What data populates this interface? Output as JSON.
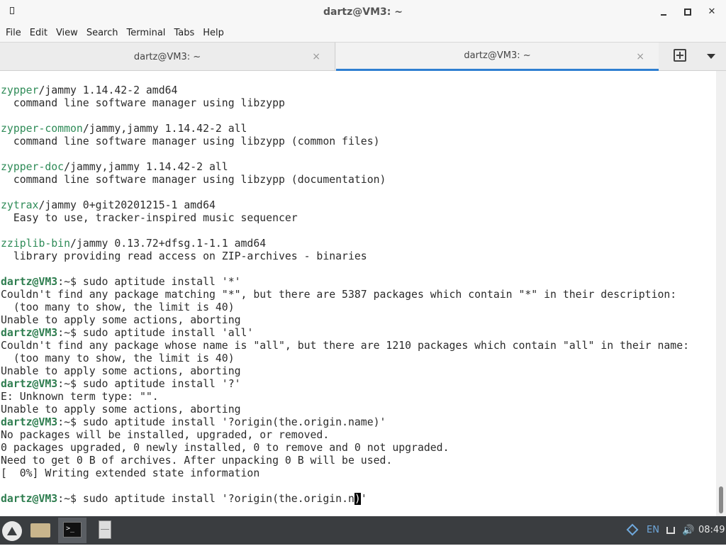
{
  "window": {
    "title": "dartz@VM3: ~"
  },
  "menu": [
    "File",
    "Edit",
    "View",
    "Search",
    "Terminal",
    "Tabs",
    "Help"
  ],
  "tabs": [
    {
      "label": "dartz@VM3: ~",
      "close": "×"
    },
    {
      "label": "dartz@VM3: ~",
      "close": "×"
    }
  ],
  "terminal": {
    "lines": [
      [
        {
          "t": "zypper",
          "c": "g"
        },
        {
          "t": "/jammy 1.14.42-2 amd64"
        }
      ],
      [
        {
          "t": "  command line software manager using libzypp"
        }
      ],
      [],
      [
        {
          "t": "zypper-common",
          "c": "g"
        },
        {
          "t": "/jammy,jammy 1.14.42-2 all"
        }
      ],
      [
        {
          "t": "  command line software manager using libzypp (common files)"
        }
      ],
      [],
      [
        {
          "t": "zypper-doc",
          "c": "g"
        },
        {
          "t": "/jammy,jammy 1.14.42-2 all"
        }
      ],
      [
        {
          "t": "  command line software manager using libzypp (documentation)"
        }
      ],
      [],
      [
        {
          "t": "zytrax",
          "c": "g"
        },
        {
          "t": "/jammy 0+git20201215-1 amd64"
        }
      ],
      [
        {
          "t": "  Easy to use, tracker-inspired music sequencer"
        }
      ],
      [],
      [
        {
          "t": "zziplib-bin",
          "c": "g"
        },
        {
          "t": "/jammy 0.13.72+dfsg.1-1.1 amd64"
        }
      ],
      [
        {
          "t": "  library providing read access on ZIP-archives - binaries"
        }
      ],
      [],
      [
        {
          "t": "dartz@VM3",
          "c": "gp"
        },
        {
          "t": ":~$ sudo aptitude install '*'"
        }
      ],
      [
        {
          "t": "Couldn't find any package matching \"*\", but there are 5387 packages which contain \"*\" in their description:"
        }
      ],
      [
        {
          "t": "  (too many to show, the limit is 40)"
        }
      ],
      [
        {
          "t": "Unable to apply some actions, aborting"
        }
      ],
      [
        {
          "t": "dartz@VM3",
          "c": "gp"
        },
        {
          "t": ":~$ sudo aptitude install 'all'"
        }
      ],
      [
        {
          "t": "Couldn't find any package whose name is \"all\", but there are 1210 packages which contain \"all\" in their name:"
        }
      ],
      [
        {
          "t": "  (too many to show, the limit is 40)"
        }
      ],
      [
        {
          "t": "Unable to apply some actions, aborting"
        }
      ],
      [
        {
          "t": "dartz@VM3",
          "c": "gp"
        },
        {
          "t": ":~$ sudo aptitude install '?'"
        }
      ],
      [
        {
          "t": "E: Unknown term type: \"\"."
        }
      ],
      [
        {
          "t": "Unable to apply some actions, aborting"
        }
      ],
      [
        {
          "t": "dartz@VM3",
          "c": "gp"
        },
        {
          "t": ":~$ sudo aptitude install '?origin(the.origin.name)'"
        }
      ],
      [
        {
          "t": "No packages will be installed, upgraded, or removed."
        }
      ],
      [
        {
          "t": "0 packages upgraded, 0 newly installed, 0 to remove and 0 not upgraded."
        }
      ],
      [
        {
          "t": "Need to get 0 B of archives. After unpacking 0 B will be used."
        }
      ],
      [
        {
          "t": "[  0%] Writing extended state information"
        }
      ],
      [],
      [
        {
          "t": "dartz@VM3",
          "c": "gp"
        },
        {
          "t": ":~$ sudo aptitude install '?origin(the.origin.n"
        },
        {
          "t": ")",
          "c": "cursor"
        },
        {
          "t": "'"
        }
      ]
    ]
  },
  "taskbar": {
    "terminal_icon_text": ">_",
    "language": "EN",
    "volume": "🔊",
    "clock": "08:49"
  }
}
